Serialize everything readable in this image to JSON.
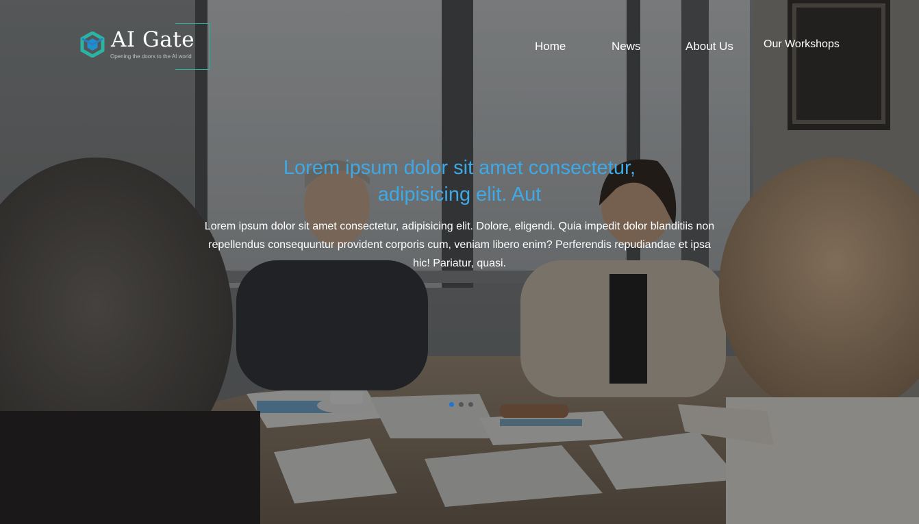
{
  "brand": {
    "name": "AI Gate",
    "tagline": "Opening the doors to the AI world",
    "logo_icon": "hexagon-logo-icon",
    "accent_color": "#2bb3a4"
  },
  "nav": {
    "items": [
      {
        "label": "Home"
      },
      {
        "label": "News"
      },
      {
        "label": "About Us"
      },
      {
        "label": "Our Workshops"
      }
    ]
  },
  "hero": {
    "background": "photo of business meeting around a conference table",
    "title": "Lorem ipsum dolor sit amet consectetur, adipisicing elit. Aut",
    "text": "Lorem ipsum dolor sit amet consectetur, adipisicing elit. Dolore, eligendi. Quia impedit dolor blanditiis non repellendus consequuntur provident corporis cum, veniam libero enim? Perferendis repudiandae et ipsa hic! Pariatur, quasi.",
    "title_color": "#3fa9e6"
  },
  "carousel": {
    "slide_count": 3,
    "active_index": 0,
    "active_color": "#1e74d6"
  }
}
